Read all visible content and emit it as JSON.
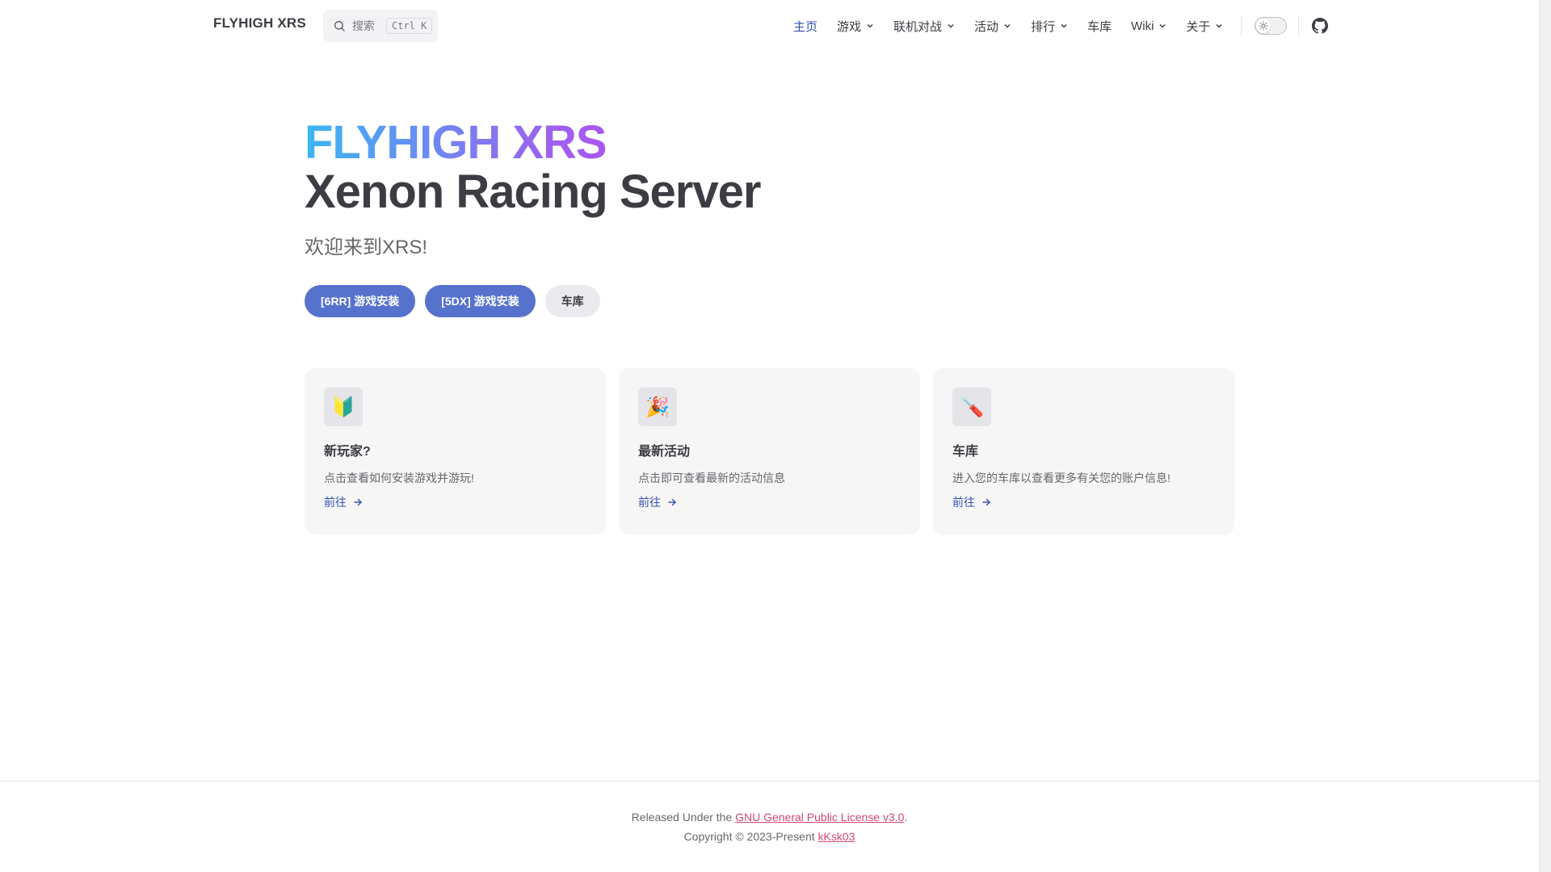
{
  "nav": {
    "brand": "FLYHIGH XRS",
    "search_placeholder": "搜索",
    "search_shortcut": "Ctrl K",
    "items": [
      {
        "label": "主页",
        "dropdown": false,
        "active": true
      },
      {
        "label": "游戏",
        "dropdown": true
      },
      {
        "label": "联机对战",
        "dropdown": true
      },
      {
        "label": "活动",
        "dropdown": true
      },
      {
        "label": "排行",
        "dropdown": true
      },
      {
        "label": "车库",
        "dropdown": false
      },
      {
        "label": "Wiki",
        "dropdown": true
      },
      {
        "label": "关于",
        "dropdown": true
      }
    ],
    "appearance_toggle_icon": "sun-icon",
    "social_icon": "github-icon"
  },
  "hero": {
    "name": "FLYHIGH XRS",
    "text": "Xenon Racing Server",
    "tagline": "欢迎来到XRS!",
    "actions": [
      {
        "label": "[6RR] 游戏安装",
        "theme": "brand"
      },
      {
        "label": "[5DX] 游戏安装",
        "theme": "brand"
      },
      {
        "label": "车库",
        "theme": "alt"
      }
    ]
  },
  "features": [
    {
      "icon": "🔰",
      "title": "新玩家?",
      "details": "点击查看如何安装游戏并游玩!",
      "link": "前往"
    },
    {
      "icon": "🎉",
      "title": "最新活动",
      "details": "点击即可查看最新的活动信息",
      "link": "前往"
    },
    {
      "icon": "🪛",
      "title": "车库",
      "details": "进入您的车库以查看更多有关您的账户信息!",
      "link": "前往"
    }
  ],
  "footer": {
    "message_prefix": "Released Under the ",
    "license_link": "GNU General Public License v3.0",
    "message_suffix": ".",
    "copyright_prefix": "Copyright © 2023-Present ",
    "author_link": "kKsk03"
  },
  "colors": {
    "brand": "#5672cd",
    "active_link": "#3451b2",
    "footer_link": "#d5467a",
    "gradient_start": "#3ab6f2",
    "gradient_end": "#c93ff0"
  }
}
